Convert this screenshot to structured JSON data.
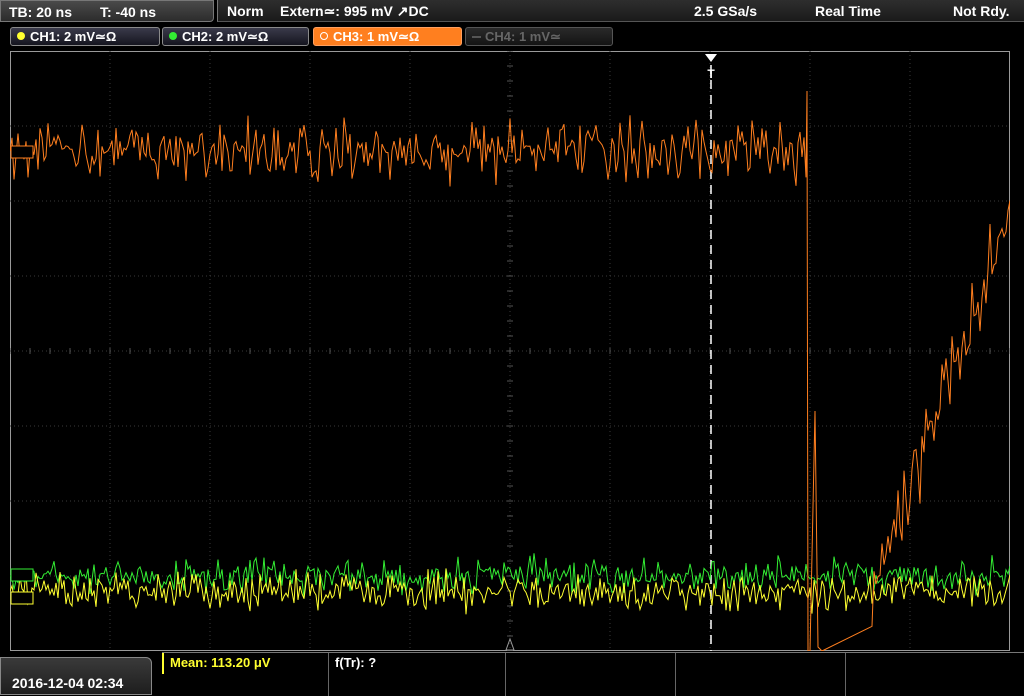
{
  "header": {
    "timebase": "TB: 20 ns",
    "trigger_time": "T: -40 ns",
    "trigger_mode": "Norm",
    "trigger_source": "Extern≃: 995 mV ↗DC",
    "sample_rate": "2.5 GSa/s",
    "acquisition": "Real Time",
    "status": "Not Rdy."
  },
  "channels": [
    {
      "label": "CH1: 2 mV≃Ω",
      "color": "#ffff30",
      "active": true
    },
    {
      "label": "CH2: 2 mV≃Ω",
      "color": "#33ee33",
      "active": true
    },
    {
      "label": "CH3: 1 mV≃Ω",
      "color": "#ff7f1f",
      "active": true,
      "selected": true
    },
    {
      "label": "CH4: 1 mV≃",
      "color": "#666666",
      "active": false
    }
  ],
  "trigger_marker": "T",
  "footer": {
    "datetime": "2016-12-04 02:34",
    "measurements": [
      {
        "label": "Mean: 113.20 μV",
        "color": "#ffff30"
      },
      {
        "label": "f(Tr): ?",
        "color": "#ffffff"
      }
    ]
  },
  "colors": {
    "ch1": "#ffff30",
    "ch2": "#33ee33",
    "ch3": "#ff7f1f",
    "grid": "#3a3a3a",
    "background": "#000000"
  }
}
